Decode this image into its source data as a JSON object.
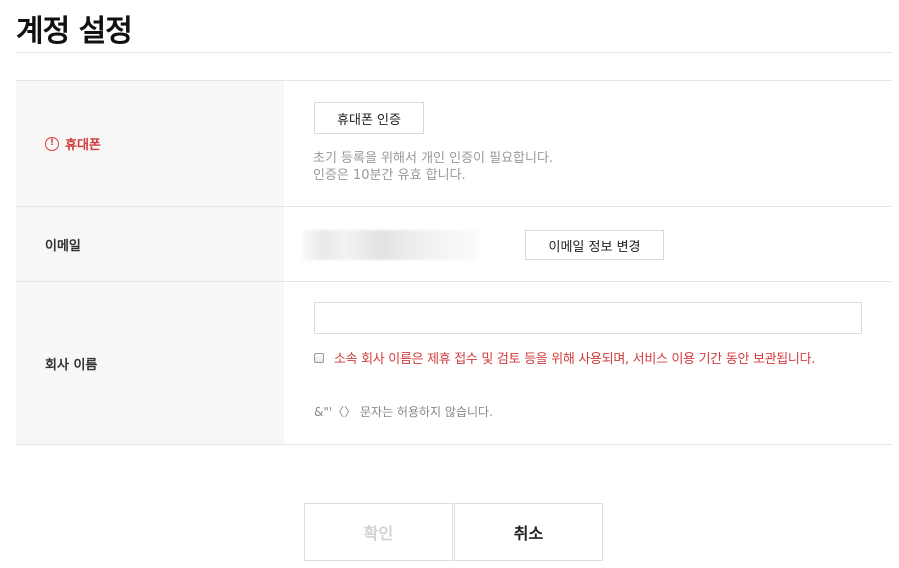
{
  "page": {
    "title": "계정 설정"
  },
  "phone_row": {
    "label": "휴대폰",
    "status_icon": "!",
    "status_color": "#d23c3c",
    "verify_button": "휴대폰 인증",
    "hint_line1": "초기 등록을 위해서 개인 인증이 필요합니다.",
    "hint_line2": "인증은 10분간 유효 합니다."
  },
  "email_row": {
    "label": "이메일",
    "change_button": "이메일 정보 변경"
  },
  "company_row": {
    "label": "회사 이름",
    "input_value": "",
    "consent_checked": false,
    "consent_text": "소속 회사 이름은 제휴 접수 및 검토 등을 위해 사용되며, 서비스 이용 기간 동안 보관됩니다.",
    "note": "&\"'〈〉 문자는 허용하지 않습니다."
  },
  "actions": {
    "confirm": "확인",
    "confirm_enabled": false,
    "cancel": "취소"
  }
}
